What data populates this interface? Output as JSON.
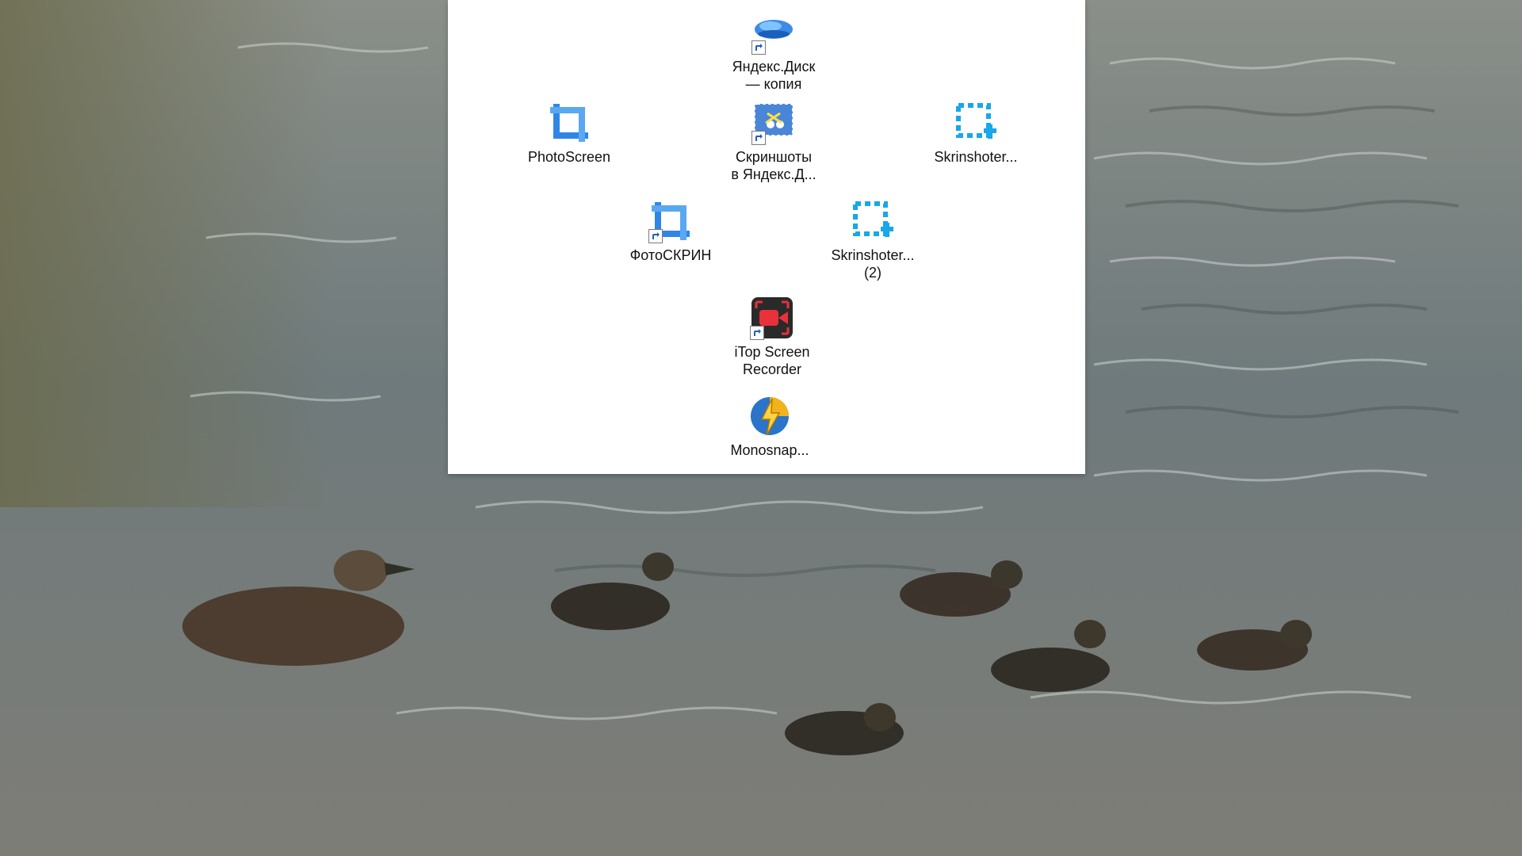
{
  "desktop": {
    "icons": [
      {
        "label": "Яндекс.Диск\n— копия",
        "icon": "yandex-disk-icon",
        "shortcut": true
      },
      {
        "label": "PhotoScreen",
        "icon": "photoscreen-crop-icon",
        "shortcut": false
      },
      {
        "label": "Скриншоты\nв Яндекс.Д...",
        "icon": "yandex-screenshots-icon",
        "shortcut": true
      },
      {
        "label": "Skrinshoter...",
        "icon": "skrinshoter-icon",
        "shortcut": false
      },
      {
        "label": "ФотоСКРИН",
        "icon": "fotoscreen-crop-icon",
        "shortcut": true
      },
      {
        "label": "Skrinshoter...\n(2)",
        "icon": "skrinshoter-icon",
        "shortcut": false
      },
      {
        "label": "iTop Screen\nRecorder",
        "icon": "itop-recorder-icon",
        "shortcut": true
      },
      {
        "label": "Monosnap...",
        "icon": "monosnap-icon",
        "shortcut": false
      }
    ]
  },
  "colors": {
    "photoscreen_blue": "#2f86e6",
    "skrinshoter_cyan": "#18a7e8",
    "itop_red": "#e8313a",
    "water": "#6f7a7c"
  }
}
